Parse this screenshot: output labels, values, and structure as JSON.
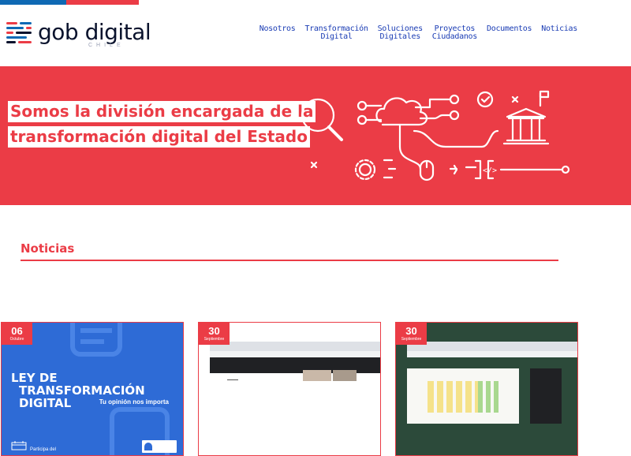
{
  "brand": {
    "name_part1": "gob",
    "name_part2": "digital",
    "subtitle": "CHILE",
    "colors": {
      "blue": "#0f69b4",
      "red": "#eb3c46",
      "navy": "#0a132d",
      "nav_link": "#1a3cb4"
    }
  },
  "nav": [
    {
      "id": "nosotros",
      "lines": [
        "Nosotros"
      ]
    },
    {
      "id": "transformacion",
      "lines": [
        "Transformación",
        "Digital"
      ]
    },
    {
      "id": "soluciones",
      "lines": [
        "Soluciones",
        "Digitales"
      ]
    },
    {
      "id": "proyectos",
      "lines": [
        "Proyectos",
        "Ciudadanos"
      ]
    },
    {
      "id": "documentos",
      "lines": [
        "Documentos"
      ]
    },
    {
      "id": "noticias",
      "lines": [
        "Noticias"
      ]
    }
  ],
  "hero": {
    "line1": "Somos la división encargada de la",
    "line2": "transformación digital del Estado",
    "illustration": "digital-transformation-line-art"
  },
  "news": {
    "section_title": "Noticias",
    "cards": [
      {
        "day": "06",
        "month": "Octubre",
        "image": "ley-transformacion-digital-banner",
        "image_title_1": "LEY DE",
        "image_title_2": "TRANSFORMACIÓN DIGITAL",
        "image_subtitle": "Tu opinión nos importa",
        "image_footer": "Participa del"
      },
      {
        "day": "30",
        "month": "Septiembre",
        "image": "video-call-browser-screenshot"
      },
      {
        "day": "30",
        "month": "Septiembre",
        "image": "online-workshop-board-screenshot"
      }
    ]
  }
}
